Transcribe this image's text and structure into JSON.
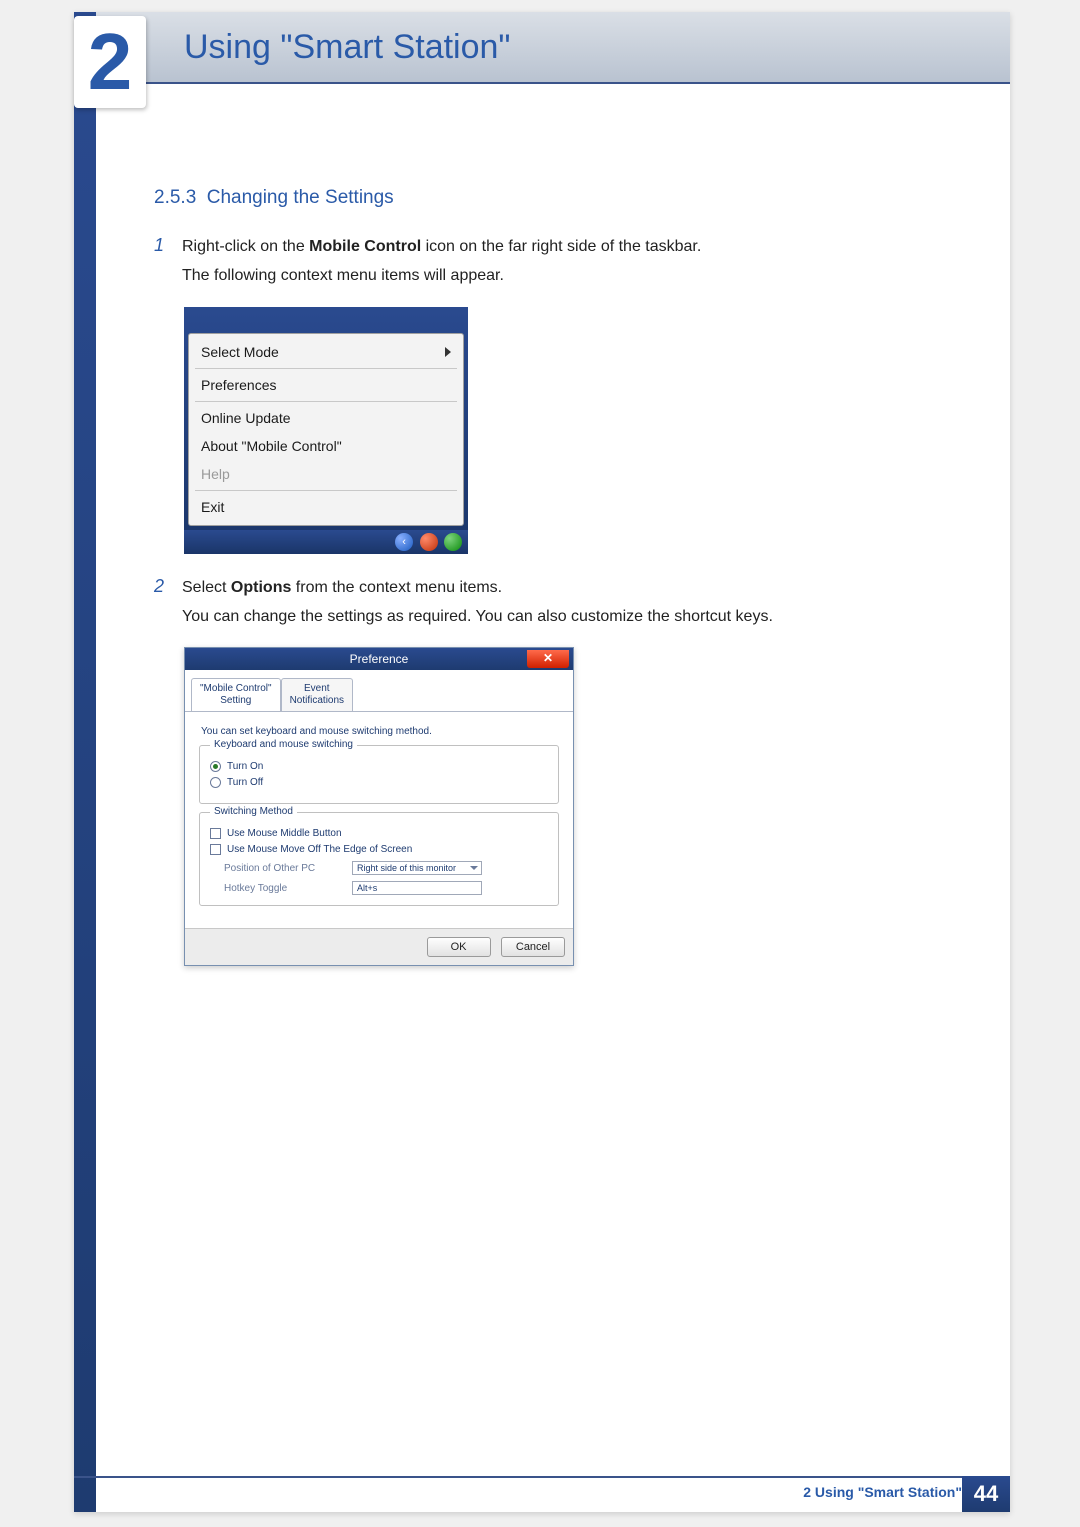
{
  "chapter": {
    "number": "2",
    "title": "Using \"Smart Station\""
  },
  "section": {
    "number": "2.5.3",
    "title": "Changing the Settings"
  },
  "steps": {
    "s1": {
      "num": "1",
      "line1_pre": "Right-click on the ",
      "line1_bold": "Mobile Control",
      "line1_post": " icon on the far right side of the taskbar.",
      "line2": "The following context menu items will appear."
    },
    "s2": {
      "num": "2",
      "line1_pre": "Select ",
      "line1_bold": "Options",
      "line1_post": " from the context menu items.",
      "line2": "You can change the settings as required. You can also customize the shortcut keys."
    }
  },
  "context_menu": {
    "items": {
      "select_mode": "Select Mode",
      "preferences": "Preferences",
      "online_update": "Online Update",
      "about": "About \"Mobile Control\"",
      "help": "Help",
      "exit": "Exit"
    }
  },
  "preference_dialog": {
    "title": "Preference",
    "close_glyph": "✕",
    "tabs": {
      "setting_l1": "\"Mobile Control\"",
      "setting_l2": "Setting",
      "event_l1": "Event",
      "event_l2": "Notifications"
    },
    "intro": "You can set keyboard and mouse switching method.",
    "group1": {
      "legend": "Keyboard and mouse switching",
      "turn_on": "Turn On",
      "turn_off": "Turn Off"
    },
    "group2": {
      "legend": "Switching Method",
      "use_middle": "Use Mouse Middle Button",
      "use_move_off": "Use Mouse Move Off The Edge of Screen",
      "position_label": "Position of Other PC",
      "position_value": "Right side of this monitor",
      "hotkey_label": "Hotkey Toggle",
      "hotkey_value": "Alt+s"
    },
    "buttons": {
      "ok": "OK",
      "cancel": "Cancel"
    }
  },
  "footer": {
    "label": "2 Using \"Smart Station\"",
    "page": "44"
  }
}
